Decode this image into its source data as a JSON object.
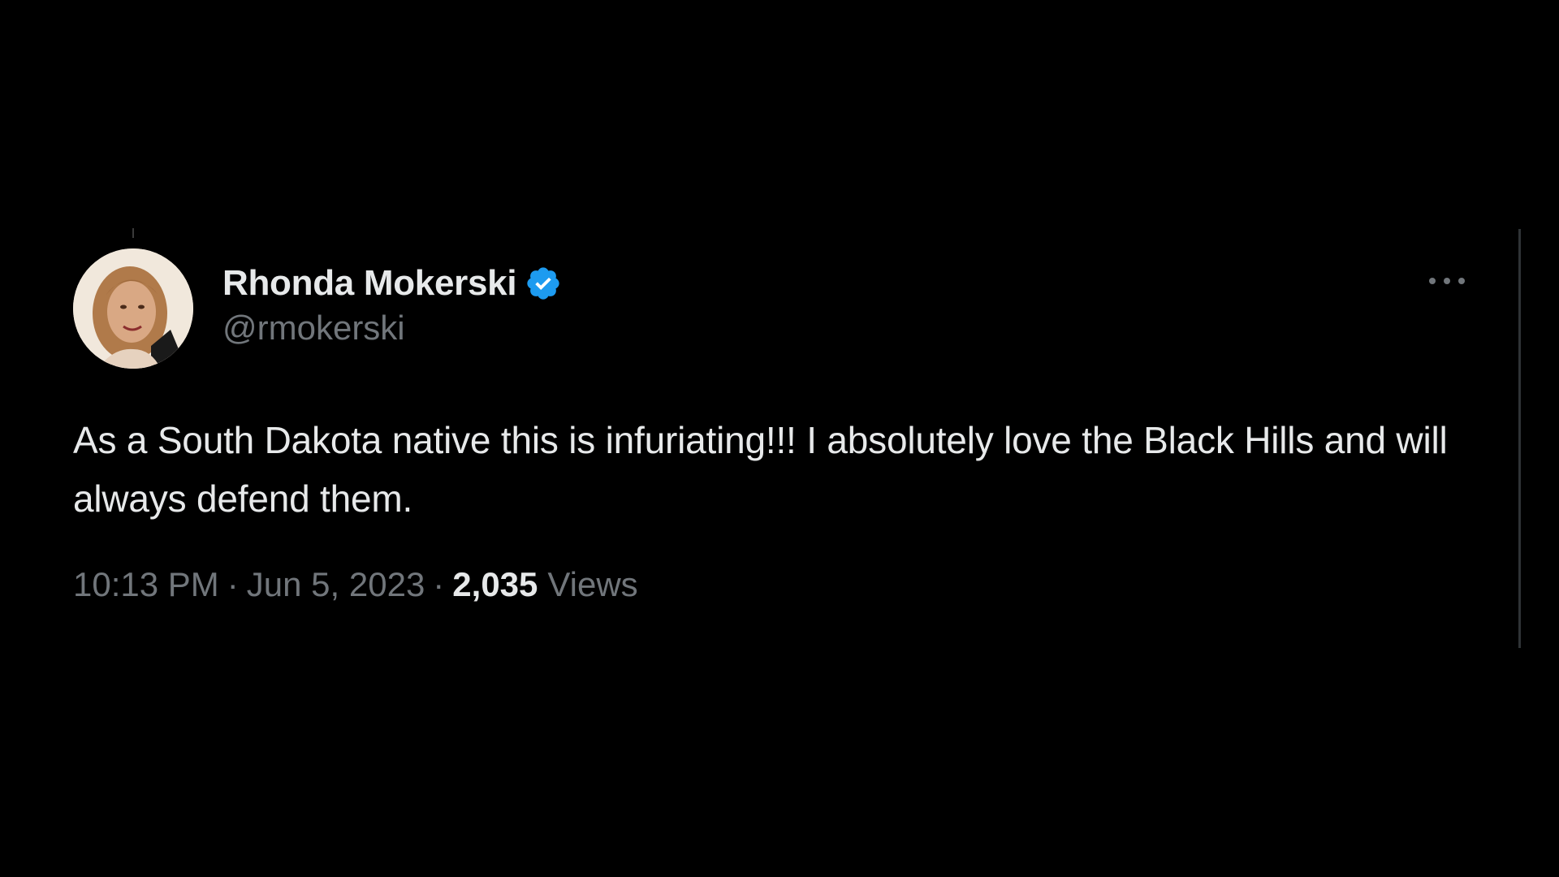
{
  "tweet": {
    "author": {
      "display_name": "Rhonda Mokerski",
      "handle": "@rmokerski",
      "verified": true,
      "avatar_icon": "user-avatar-photo"
    },
    "text": "As a South Dakota native this is infuriating!!! I absolutely love the Black Hills and will always defend them.",
    "time": "10:13 PM",
    "date": "Jun 5, 2023",
    "separator": "·",
    "views_count": "2,035",
    "views_label": "Views",
    "more_icon": "more-options-icon"
  },
  "colors": {
    "background": "#000000",
    "primary_text": "#e7e9ea",
    "secondary_text": "#71767b",
    "verified_blue": "#1d9bf0"
  }
}
